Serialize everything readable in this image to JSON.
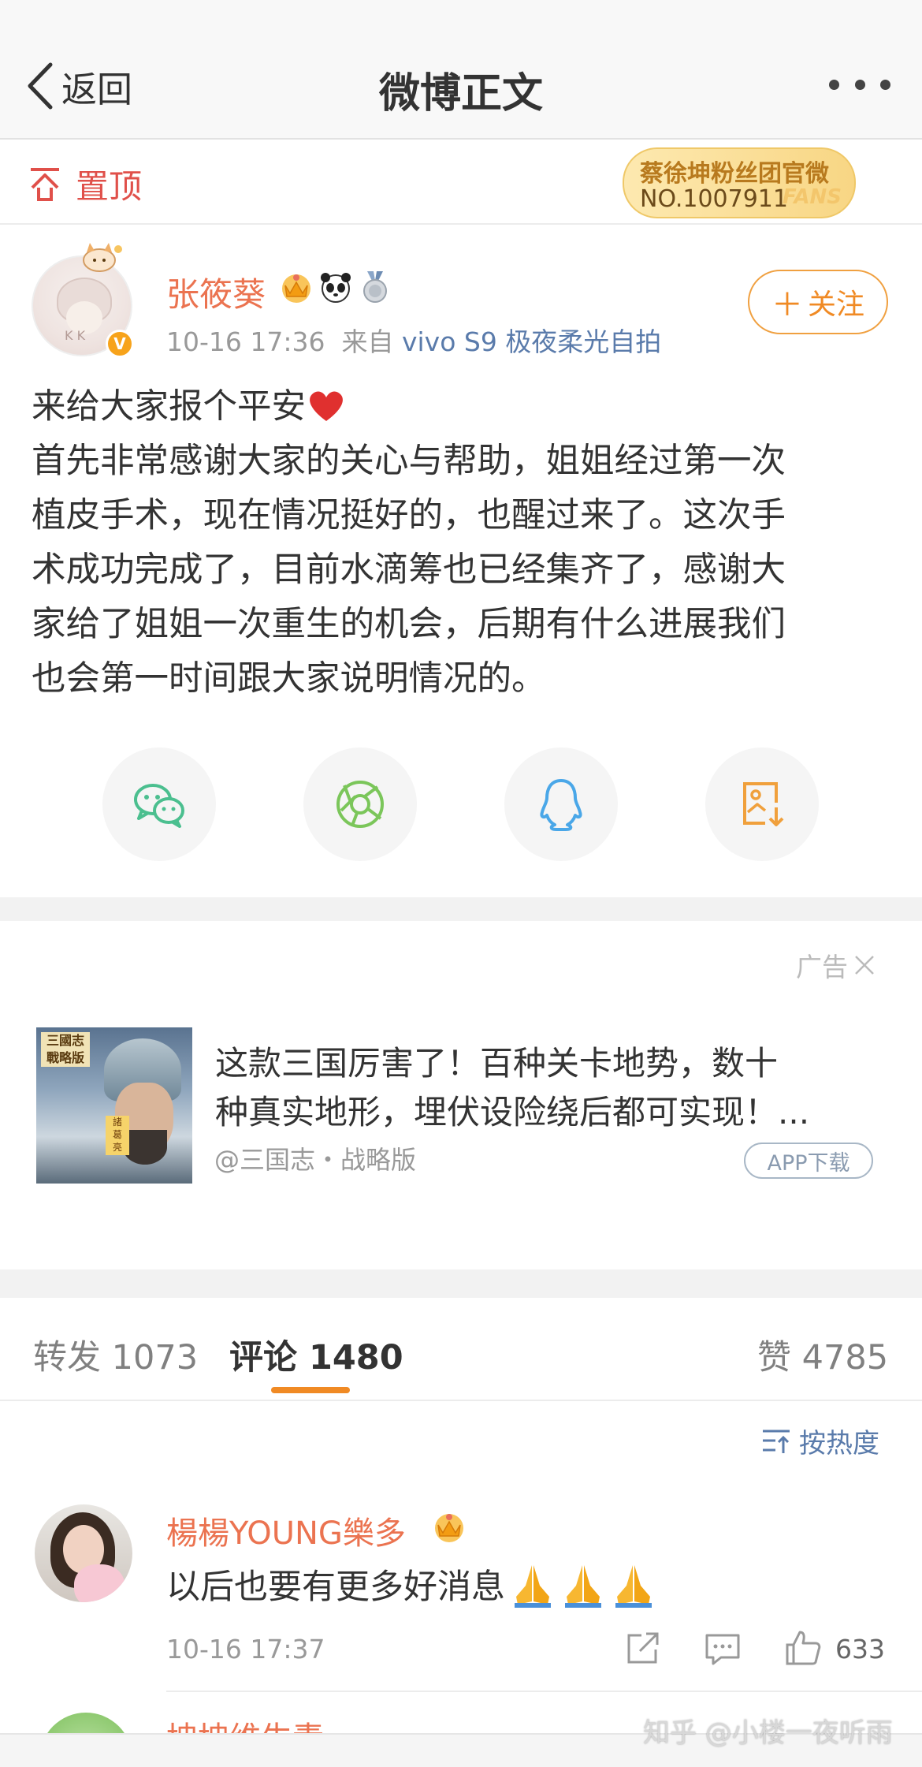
{
  "nav": {
    "back_label": "返回",
    "title": "微博正文"
  },
  "pin": {
    "label": "置顶"
  },
  "fans_badge": {
    "name": "蔡徐坤粉丝团官微",
    "number": "NO.1007911",
    "tag": "FANS"
  },
  "post": {
    "author": "张筱葵",
    "time": "10-16 17:36",
    "source_prefix": "来自",
    "source": "vivo S9 极夜柔光自拍",
    "follow_label": "关注",
    "lines": [
      "来给大家报个平安",
      "首先非常感谢大家的关心与帮助，姐姐经过第一次",
      "植皮手术，现在情况挺好的，也醒过来了。这次手",
      "术成功完成了，目前水滴筹也已经集齐了，感谢大",
      "家给了姐姐一次重生的机会，后期有什么进展我们",
      "也会第一时间跟大家说明情况的。"
    ]
  },
  "share": {
    "items": [
      "wechat-icon",
      "moments-icon",
      "qq-icon",
      "save-image-icon"
    ]
  },
  "ad": {
    "label": "广告",
    "title_lines": [
      "这款三国厉害了！百种关卡地势，数十",
      "种真实地形，埋伏设险绕后都可实现！..."
    ],
    "source": "@三国志・战略版",
    "button": "APP下载"
  },
  "tabs": {
    "repost": "转发 1073",
    "comment": "评论 1480",
    "like": "赞 4785"
  },
  "sort": {
    "label": "按热度"
  },
  "comments": [
    {
      "name": "楊楊YOUNG樂多",
      "text": "以后也要有更多好消息",
      "time": "10-16 17:37",
      "likes": "633"
    }
  ],
  "next_comment": {
    "name": "坤坤维生素"
  },
  "watermark": "知乎 @小楼一夜听雨",
  "colors": {
    "username": "#eb7350",
    "accent_orange": "#f08a24",
    "link_blue": "#5a7bab",
    "pin_red": "#e0504a"
  }
}
